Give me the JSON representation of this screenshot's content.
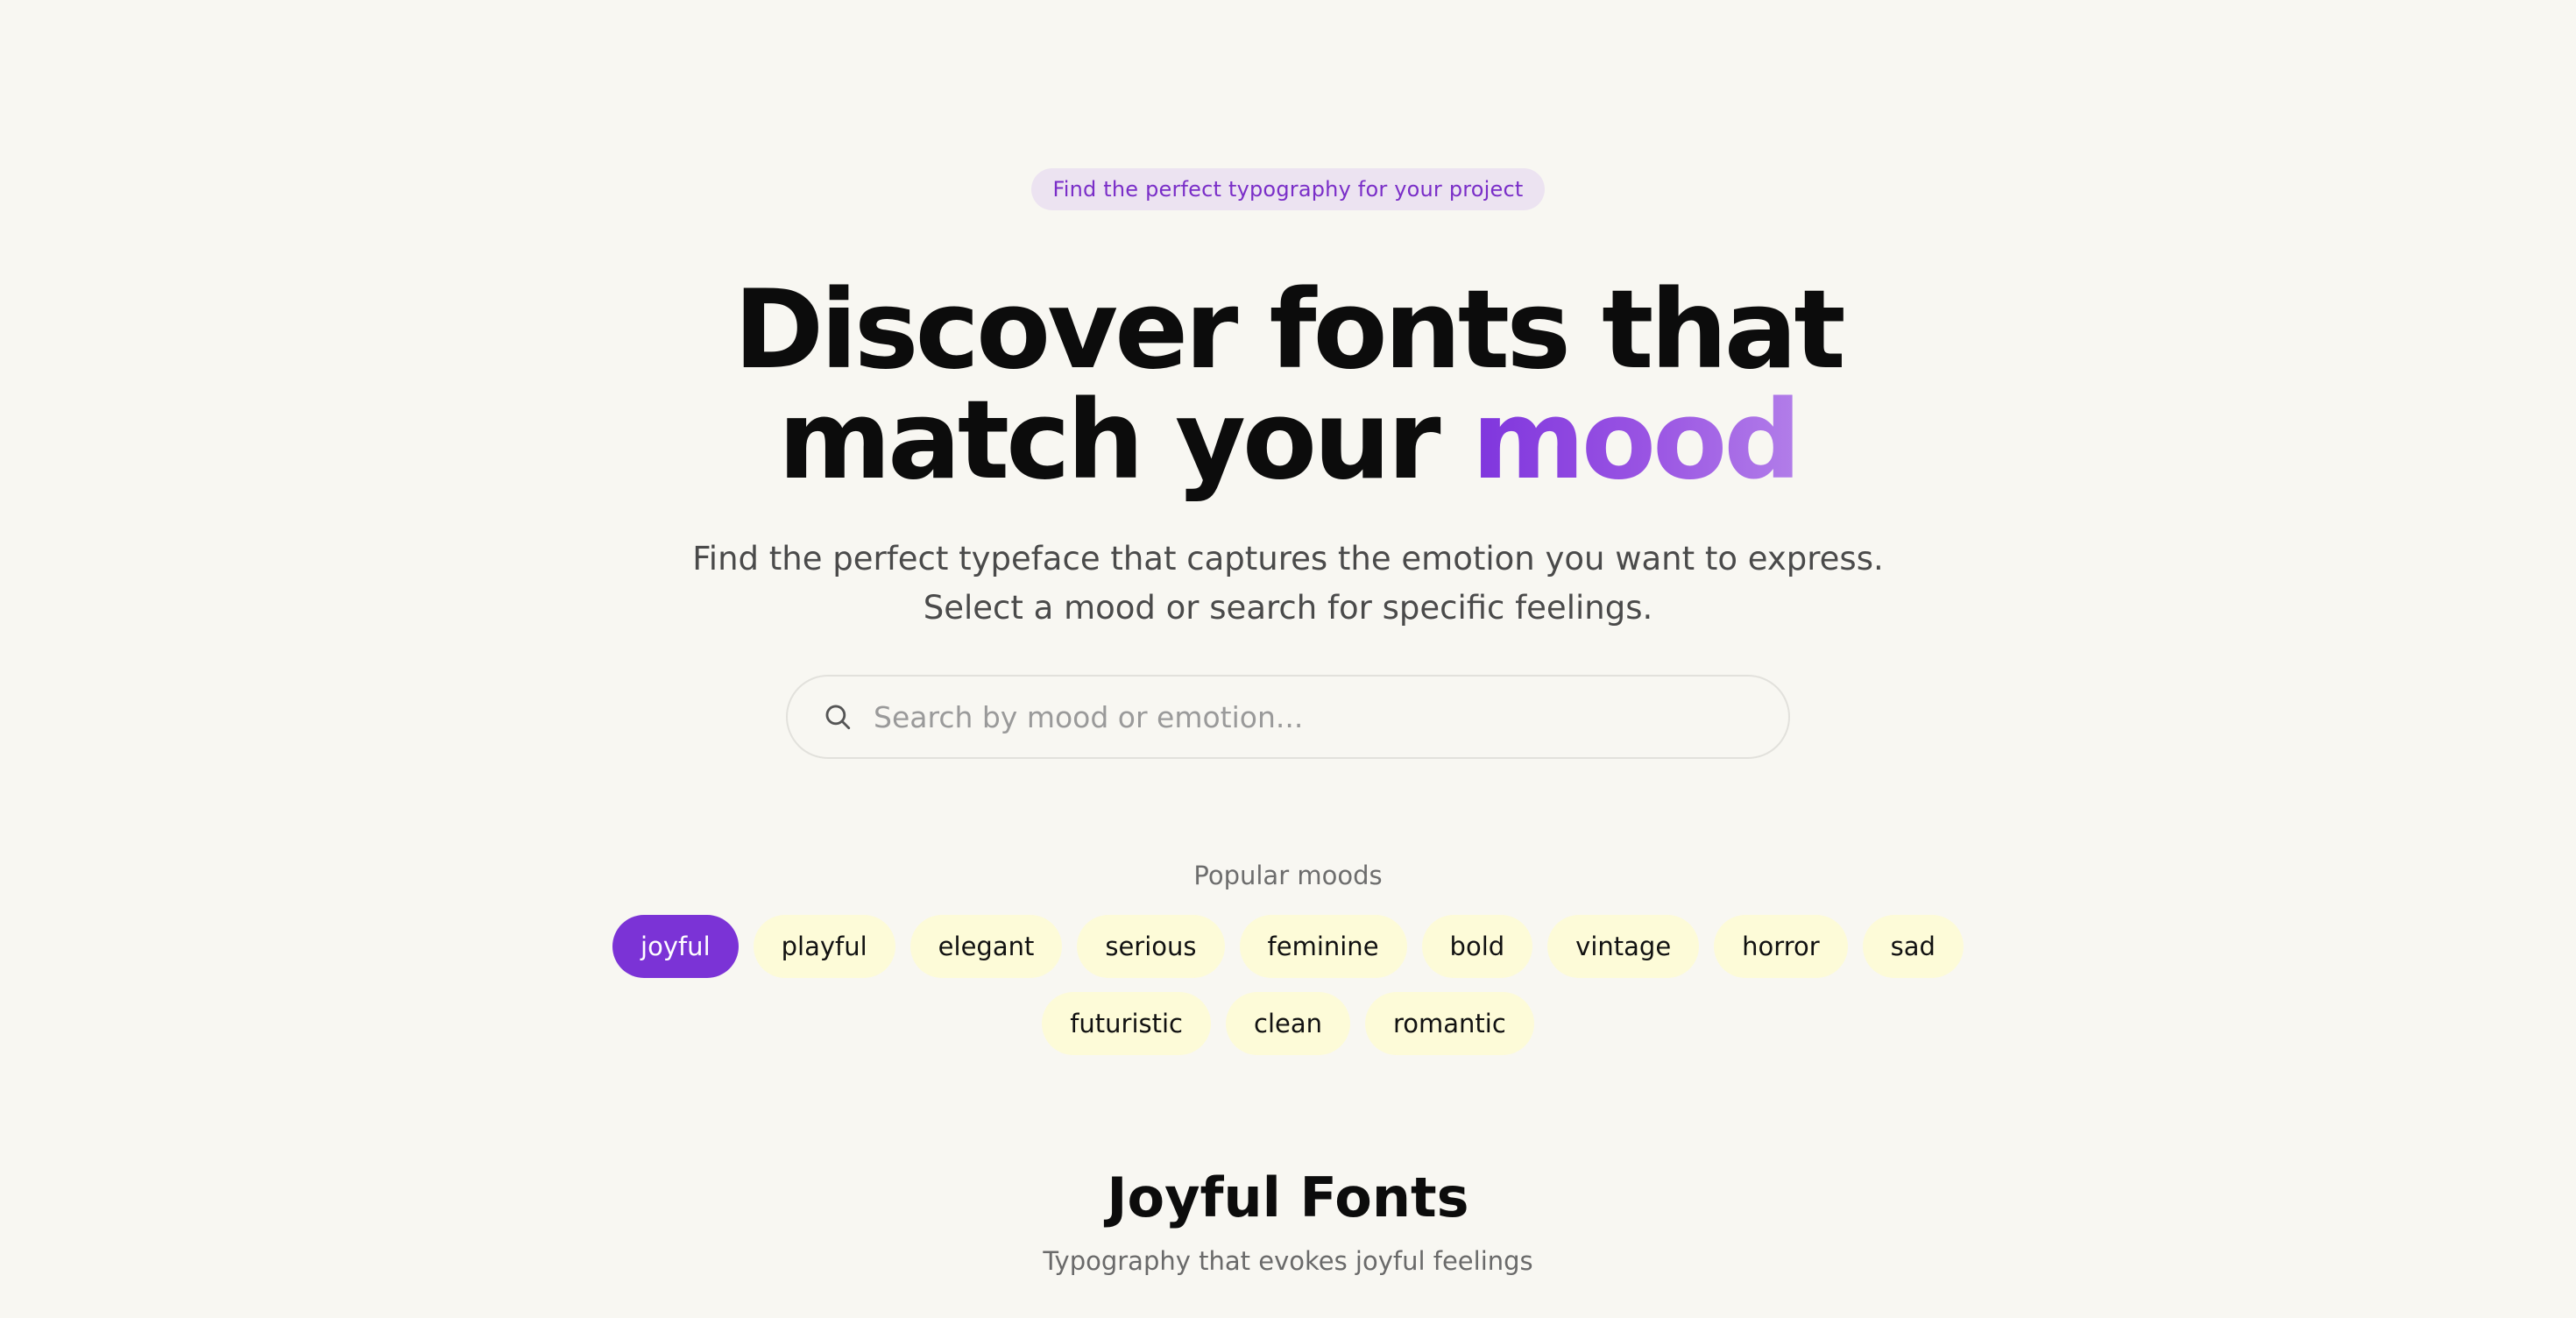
{
  "badge": {
    "text": "Find the perfect typography for your project"
  },
  "hero": {
    "title_line1": "Discover fonts that",
    "title_line2_prefix": "match your ",
    "title_accent": "mood"
  },
  "subtitle": {
    "line1": "Find the perfect typeface that captures the emotion you want to express.",
    "line2": "Select a mood or search for specific feelings."
  },
  "search": {
    "placeholder": "Search by mood or emotion...",
    "value": "",
    "icon": "search-icon"
  },
  "moods": {
    "label": "Popular moods",
    "selected": "joyful",
    "row1": [
      "joyful",
      "playful",
      "elegant",
      "serious",
      "feminine",
      "bold",
      "vintage",
      "horror",
      "sad"
    ],
    "row2": [
      "futuristic",
      "clean",
      "romantic"
    ]
  },
  "results": {
    "title": "Joyful Fonts",
    "subtitle": "Typography that evokes joyful feelings"
  },
  "colors": {
    "background": "#f8f7f2",
    "accent": "#7b33d6",
    "chip": "#fdfbd8",
    "badge_bg": "#ece3f1",
    "badge_text": "#7a2ec8"
  }
}
